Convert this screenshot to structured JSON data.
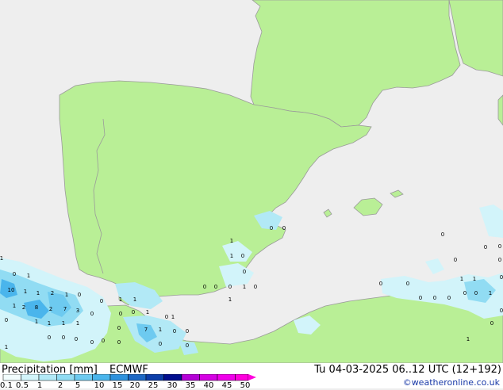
{
  "title": "Precipitation [mm]",
  "model": "ECMWF",
  "valid_time": "Tu 04-03-2025 06..12 UTC (12+192)",
  "credit": "©weatheronline.co.uk",
  "colors": {
    "sea": "#eeeeee",
    "land": "#b9ef96",
    "coast": "#9a9a9a"
  },
  "legend": {
    "ticks": [
      "0.1",
      "0.5",
      "1",
      "2",
      "5",
      "10",
      "15",
      "20",
      "25",
      "30",
      "35",
      "40",
      "45",
      "50"
    ],
    "colors": [
      "#f2fdfe",
      "#d2f4fa",
      "#b2e9f6",
      "#91dcf3",
      "#6dcaf0",
      "#4ab5ec",
      "#2f92dd",
      "#1d68c4",
      "#0d3ea9",
      "#020f8e",
      "#b402d6",
      "#d502e3",
      "#f000ea",
      "#ff00dd"
    ]
  },
  "map_labels": [
    "1",
    "0",
    "1",
    "10",
    "1",
    "1",
    "2",
    "1",
    "1",
    "2",
    "8",
    "2",
    "7",
    "3",
    "0",
    "1",
    "1",
    "1",
    "1",
    "0",
    "0",
    "0",
    "1",
    "1",
    "0",
    "0",
    "1",
    "0",
    "0",
    "0",
    "0",
    "0",
    "7",
    "1",
    "0",
    "0",
    "1",
    "0",
    "0",
    "0",
    "1",
    "0",
    "0",
    "0",
    "0",
    "1",
    "0",
    "1",
    "1",
    "0",
    "0",
    "1",
    "0",
    "0",
    "0",
    "0",
    "0",
    "0",
    "0",
    "0",
    "0",
    "0",
    "0",
    "0",
    "1",
    "1",
    "1",
    "0",
    "0",
    "0",
    "0",
    "0",
    "1",
    "0"
  ]
}
